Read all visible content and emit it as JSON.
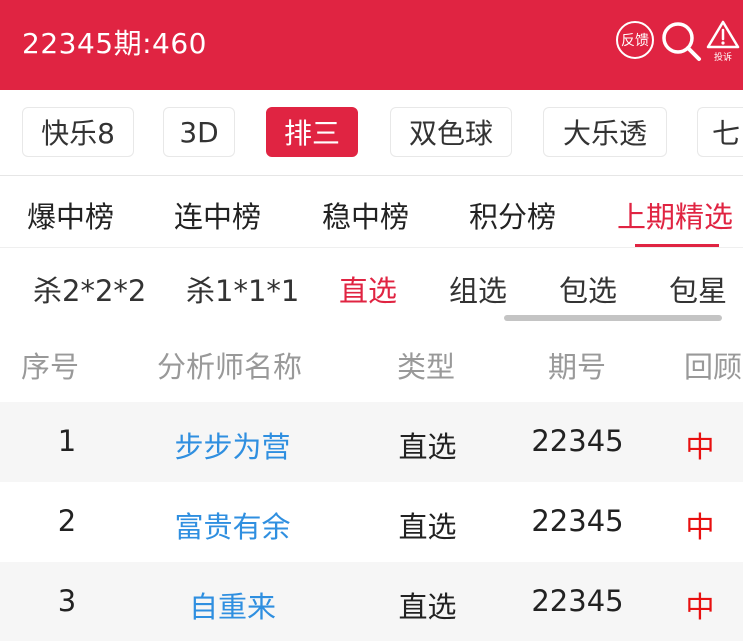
{
  "header": {
    "title": "22345期:460",
    "feedback_label": "反馈",
    "complaint_label": "投诉"
  },
  "lottery_tabs": [
    {
      "label": "快乐8",
      "active": false
    },
    {
      "label": "3D",
      "active": false
    },
    {
      "label": "排三",
      "active": true
    },
    {
      "label": "双色球",
      "active": false
    },
    {
      "label": "大乐透",
      "active": false
    },
    {
      "label": "七",
      "active": false
    }
  ],
  "rank_tabs": [
    {
      "label": "爆中榜",
      "active": false
    },
    {
      "label": "连中榜",
      "active": false
    },
    {
      "label": "稳中榜",
      "active": false
    },
    {
      "label": "积分榜",
      "active": false
    },
    {
      "label": "上期精选",
      "active": true
    }
  ],
  "sub_tabs": [
    {
      "label": "杀2*2*2",
      "active": false
    },
    {
      "label": "杀1*1*1",
      "active": false
    },
    {
      "label": "直选",
      "active": true
    },
    {
      "label": "组选",
      "active": false
    },
    {
      "label": "包选",
      "active": false
    },
    {
      "label": "包星",
      "active": false
    }
  ],
  "table": {
    "headers": [
      "序号",
      "分析师名称",
      "类型",
      "期号",
      "回顾"
    ],
    "rows": [
      {
        "no": "1",
        "name": "步步为营",
        "type": "直选",
        "period": "22345",
        "result": "中"
      },
      {
        "no": "2",
        "name": "富贵有余",
        "type": "直选",
        "period": "22345",
        "result": "中"
      },
      {
        "no": "3",
        "name": "自重来",
        "type": "直选",
        "period": "22345",
        "result": "中"
      }
    ]
  },
  "colors": {
    "brand": "#e02442",
    "link": "#2f8fe0",
    "hit": "#e81010"
  }
}
